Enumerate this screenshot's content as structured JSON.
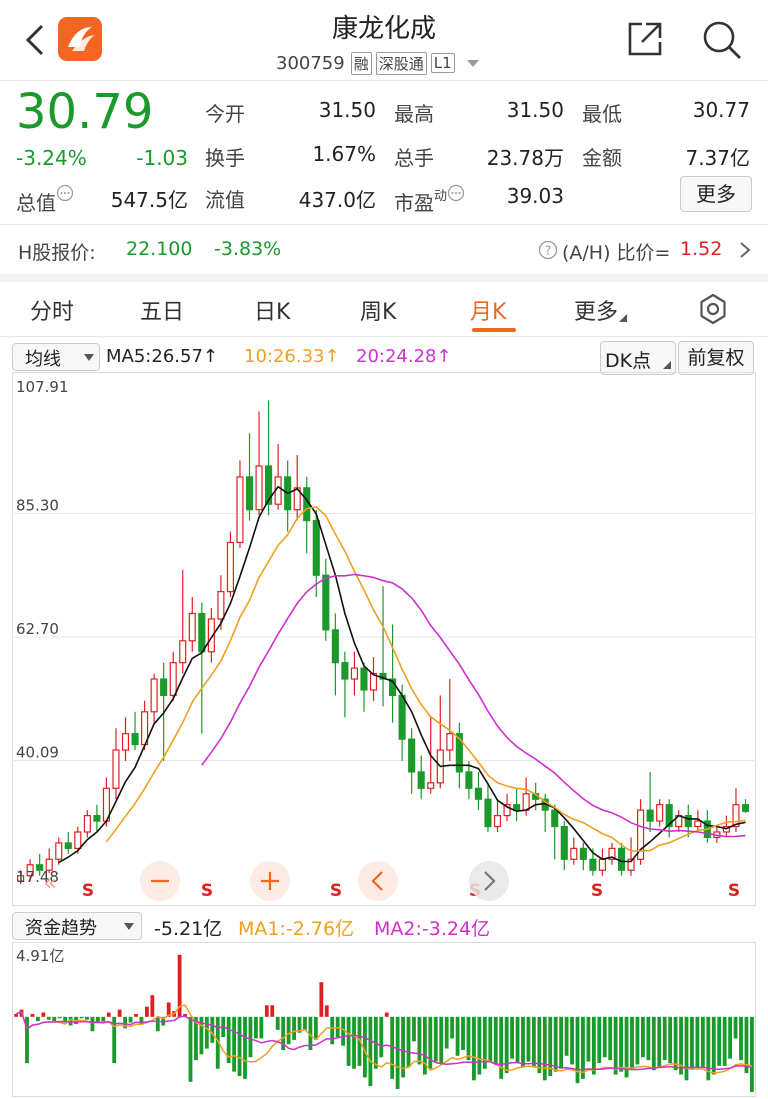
{
  "header": {
    "title": "康龙化成",
    "code": "300759",
    "tags": [
      "融",
      "深股通",
      "L1"
    ]
  },
  "quote": {
    "price": "30.79",
    "change_pct": "-3.24%",
    "change": "-1.03",
    "open_label": "今开",
    "open": "31.50",
    "high_label": "最高",
    "high": "31.50",
    "low_label": "最低",
    "low": "30.77",
    "turnover_label": "换手",
    "turnover": "1.67%",
    "volume_label": "总手",
    "volume": "23.78万",
    "amount_label": "金额",
    "amount": "7.37亿",
    "mcap_label": "总值",
    "mcap": "547.5亿",
    "float_label": "流值",
    "float": "437.0亿",
    "pe_label": "市盈",
    "pe_sup": "动",
    "pe": "39.03",
    "more_label": "更多"
  },
  "hshare": {
    "label": "H股报价:",
    "price": "22.100",
    "pct": "-3.83%",
    "ratio_label": "(A/H) 比价=",
    "ratio": "1.52"
  },
  "tabs": [
    "分时",
    "五日",
    "日K",
    "周K",
    "月K",
    "更多"
  ],
  "active_tab": "月K",
  "ma_bar": {
    "mode": "均线",
    "ma5": "MA5:26.57↑",
    "ma10": "10:26.33↑",
    "ma20": "20:24.28↑",
    "dk": "DK点",
    "adjust": "前复权"
  },
  "kline_axis": {
    "labels": [
      "107.91",
      "85.30",
      "62.70",
      "40.09",
      "17.48"
    ]
  },
  "signal_letter": "S",
  "fund": {
    "mode": "资金趋势",
    "value": "-5.21亿",
    "ma1": "MA1:-2.76亿",
    "ma2": "MA2:-3.24亿",
    "axis_top": "4.91亿"
  },
  "colors": {
    "up": "#e02020",
    "down": "#1a9a2a",
    "ma5": "#111111",
    "ma10": "#f0a020",
    "ma20": "#d030d0",
    "accent": "#f26522"
  },
  "chart_data": [
    {
      "type": "candlestick",
      "title": "月K",
      "ylim": [
        17.48,
        107.91
      ],
      "ytick_labels": [
        "107.91",
        "85.30",
        "62.70",
        "40.09",
        "17.48"
      ],
      "series": [
        {
          "name": "MA5",
          "value": 26.57
        },
        {
          "name": "MA10",
          "value": 26.33
        },
        {
          "name": "MA20",
          "value": 24.28
        }
      ],
      "candles": [
        [
          18,
          19,
          17.5,
          20
        ],
        [
          19,
          21,
          18,
          22
        ],
        [
          21,
          20,
          19,
          23
        ],
        [
          20,
          22,
          19.5,
          24
        ],
        [
          22,
          25,
          21,
          26
        ],
        [
          25,
          24,
          23,
          27
        ],
        [
          24,
          27,
          23,
          28
        ],
        [
          27,
          30,
          26,
          31
        ],
        [
          30,
          29,
          27,
          32
        ],
        [
          29,
          35,
          28,
          37
        ],
        [
          35,
          42,
          33,
          46
        ],
        [
          42,
          45,
          40,
          48
        ],
        [
          45,
          43,
          42,
          49
        ],
        [
          43,
          49,
          42,
          51
        ],
        [
          49,
          55,
          47,
          56
        ],
        [
          55,
          52,
          40,
          58
        ],
        [
          52,
          58,
          51,
          60
        ],
        [
          58,
          62,
          56,
          75
        ],
        [
          62,
          67,
          60,
          70
        ],
        [
          67,
          60,
          45,
          69
        ],
        [
          60,
          66,
          58,
          68
        ],
        [
          66,
          71,
          64,
          74
        ],
        [
          71,
          80,
          70,
          82
        ],
        [
          80,
          92,
          79,
          95
        ],
        [
          92,
          86,
          84,
          100
        ],
        [
          86,
          94,
          85,
          104
        ],
        [
          94,
          87,
          85,
          106
        ],
        [
          87,
          92,
          86,
          98
        ],
        [
          92,
          86,
          82,
          95
        ],
        [
          86,
          90,
          84,
          96
        ],
        [
          90,
          84,
          78,
          92
        ],
        [
          84,
          74,
          70,
          86
        ],
        [
          74,
          64,
          62,
          77
        ],
        [
          64,
          58,
          52,
          67
        ],
        [
          58,
          55,
          48,
          60
        ],
        [
          55,
          57,
          52,
          60
        ],
        [
          57,
          53,
          49,
          58
        ],
        [
          53,
          56,
          51,
          59
        ],
        [
          56,
          55,
          50,
          72
        ],
        [
          55,
          52,
          47,
          65
        ],
        [
          52,
          44,
          40,
          54
        ],
        [
          44,
          38,
          34,
          46
        ],
        [
          38,
          35,
          33,
          41
        ],
        [
          35,
          36,
          34,
          48
        ],
        [
          36,
          42,
          35,
          52
        ],
        [
          42,
          45,
          40,
          55
        ],
        [
          45,
          38,
          35,
          47
        ],
        [
          38,
          35,
          33,
          40
        ],
        [
          35,
          33,
          31,
          38
        ],
        [
          33,
          28,
          27,
          36
        ],
        [
          28,
          30,
          27,
          33
        ],
        [
          30,
          32,
          29,
          34
        ],
        [
          32,
          31,
          29,
          35
        ],
        [
          31,
          34,
          30,
          37
        ],
        [
          34,
          33,
          31,
          36
        ],
        [
          33,
          31,
          27,
          34
        ],
        [
          31,
          28,
          22,
          32
        ],
        [
          28,
          22,
          20,
          29
        ],
        [
          22,
          24,
          21,
          26
        ],
        [
          24,
          22,
          20,
          25
        ],
        [
          22,
          20,
          19,
          24
        ],
        [
          20,
          22,
          19,
          24
        ],
        [
          22,
          24,
          21,
          25
        ],
        [
          24,
          20,
          19,
          25
        ],
        [
          20,
          22,
          19,
          26
        ],
        [
          22,
          31,
          21,
          33
        ],
        [
          31,
          29,
          27,
          38
        ],
        [
          29,
          32,
          28,
          33
        ],
        [
          32,
          28,
          26,
          33
        ],
        [
          28,
          30,
          27,
          31
        ],
        [
          30,
          28,
          26,
          32
        ],
        [
          28,
          29,
          27,
          31
        ],
        [
          29,
          26,
          25,
          31
        ],
        [
          26,
          27,
          25,
          28
        ],
        [
          27,
          28,
          26,
          30
        ],
        [
          28,
          32,
          27,
          35
        ],
        [
          32,
          30.79,
          30.5,
          33
        ]
      ]
    },
    {
      "type": "bar",
      "title": "资金趋势",
      "ylim": [
        -5.21,
        4.91
      ],
      "values": [
        0.2,
        0.5,
        -3.2,
        0.2,
        -0.3,
        0.3,
        -0.2,
        -0.3,
        -0.1,
        -0.4,
        -0.6,
        -0.5,
        -0.1,
        -0.2,
        -1.0,
        -0.4,
        -0.3,
        0.3,
        -3.2,
        0.5,
        -0.8,
        -0.4,
        0.2,
        -0.5,
        0.7,
        1.5,
        -1.0,
        -0.6,
        1.0,
        0.4,
        4.3,
        0.2,
        -4.5,
        -3.0,
        -2.6,
        -2.2,
        -1.8,
        -3.6,
        -1.4,
        -3.2,
        -3.8,
        -4.1,
        -4.3,
        -2.8,
        -1.5,
        -1.5,
        0.8,
        0.8,
        -0.9,
        -2.3,
        -1.9,
        -1.6,
        -1.1,
        -0.9,
        -2.3,
        -1.6,
        2.4,
        0.8,
        -1.9,
        -1.4,
        -2.0,
        -3.4,
        -3.6,
        -3.4,
        -4.2,
        -4.8,
        -3.6,
        -2.8,
        0.3,
        -4.3,
        -5.0,
        -4.2,
        -3.5,
        -1.7,
        -3.3,
        -4.0,
        -3.6,
        -3.1,
        -3.2,
        -2.2,
        -1.5,
        -2.7,
        -2.3,
        -3.0,
        -4.4,
        -4.0,
        -3.6,
        -3.1,
        -3.3,
        -4.3,
        -3.9,
        -2.9,
        -3.2,
        -3.5,
        -3.1,
        -3.5,
        -3.9,
        -4.4,
        -4.1,
        -3.8,
        -3.6,
        -2.7,
        -3.3,
        -4.6,
        -4.3,
        -3.1,
        -4.0,
        -3.2,
        -2.8,
        -3.0,
        -4.0,
        -3.8,
        -4.2,
        -3.6,
        -3.3,
        -2.8,
        -3.0,
        -3.7,
        -3.5,
        -3.0,
        -3.2,
        -3.7,
        -4.0,
        -4.4,
        -3.6,
        -3.5,
        -3.5,
        -4.4,
        -4.0,
        -3.4,
        -3.4,
        -2.9,
        -1.5,
        -3.0,
        -3.9,
        -5.21
      ]
    }
  ]
}
